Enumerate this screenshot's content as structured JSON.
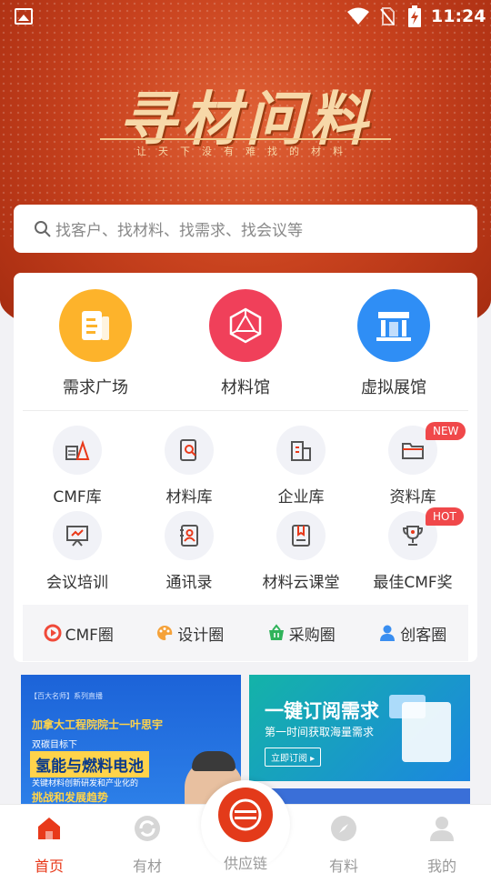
{
  "status_bar": {
    "time": "11:24"
  },
  "hero": {
    "title": "寻材问料",
    "slogan": "让天下没有难找的材料"
  },
  "search": {
    "placeholder": "找客户、找材料、找需求、找会议等",
    "icon": "search-icon"
  },
  "main_entries": [
    {
      "label": "需求广场",
      "icon": "document-icon",
      "color": "#fdb32b"
    },
    {
      "label": "材料馆",
      "icon": "polyhedron-icon",
      "color": "#f0405a"
    },
    {
      "label": "虚拟展馆",
      "icon": "pavilion-icon",
      "color": "#2f8ef5"
    }
  ],
  "grid_items": [
    {
      "label": "CMF库",
      "icon": "shapes-icon"
    },
    {
      "label": "材料库",
      "icon": "search-doc-icon"
    },
    {
      "label": "企业库",
      "icon": "building-icon"
    },
    {
      "label": "资料库",
      "icon": "folder-icon",
      "badge": "NEW"
    },
    {
      "label": "会议培训",
      "icon": "presentation-icon"
    },
    {
      "label": "通讯录",
      "icon": "contacts-icon"
    },
    {
      "label": "材料云课堂",
      "icon": "bookmark-book-icon"
    },
    {
      "label": "最佳CMF奖",
      "icon": "trophy-icon",
      "badge": "HOT"
    }
  ],
  "circles": [
    {
      "label": "CMF圈",
      "icon": "play-circle-icon",
      "color": "#f04a3a"
    },
    {
      "label": "设计圈",
      "icon": "palette-icon",
      "color": "#f5a23a"
    },
    {
      "label": "采购圈",
      "icon": "basket-icon",
      "color": "#2fb35a"
    },
    {
      "label": "创客圈",
      "icon": "user-icon",
      "color": "#3a8ef0"
    }
  ],
  "banners": {
    "left": {
      "tag": "【百大名师】系列直播",
      "line1": "加拿大工程院院士一叶思宇",
      "line2": "双碳目标下",
      "line3": "氢能与燃料电池",
      "line4": "关键材料创新研发和产业化的",
      "line5": "挑战和发展趋势"
    },
    "right": {
      "title": "一键订阅需求",
      "subtitle": "第一时间获取海量需求",
      "button": "立即订阅 ▸"
    }
  },
  "tabbar": [
    {
      "label": "首页",
      "icon": "home-icon",
      "active": true
    },
    {
      "label": "有材",
      "icon": "refresh-circle-icon",
      "active": false
    },
    {
      "label": "供应链",
      "icon": "supply-chain-icon",
      "active": false
    },
    {
      "label": "有料",
      "icon": "compass-icon",
      "active": false
    },
    {
      "label": "我的",
      "icon": "profile-icon",
      "active": false
    }
  ],
  "colors": {
    "brand": "#e8391a",
    "hero": "#c8421e"
  }
}
